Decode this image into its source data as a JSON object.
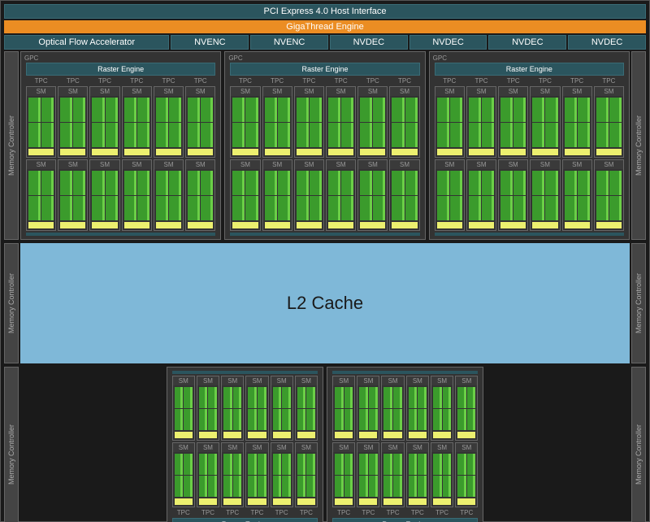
{
  "pci": "PCI Express 4.0 Host Interface",
  "giga": "GigaThread Engine",
  "ofa": "Optical Flow Accelerator",
  "encoders": [
    "NVENC",
    "NVENC",
    "NVDEC",
    "NVDEC",
    "NVDEC",
    "NVDEC"
  ],
  "mem": "Memory Controller",
  "gpc": "GPC",
  "raster": "Raster Engine",
  "tpc": "TPC",
  "sm": "SM",
  "cache": "L2 Cache",
  "architecture": {
    "top_gpc_count": 3,
    "bottom_gpc_count": 2,
    "tpc_per_gpc": 6,
    "sm_per_tpc": 2,
    "memory_controllers_per_side": 3
  }
}
